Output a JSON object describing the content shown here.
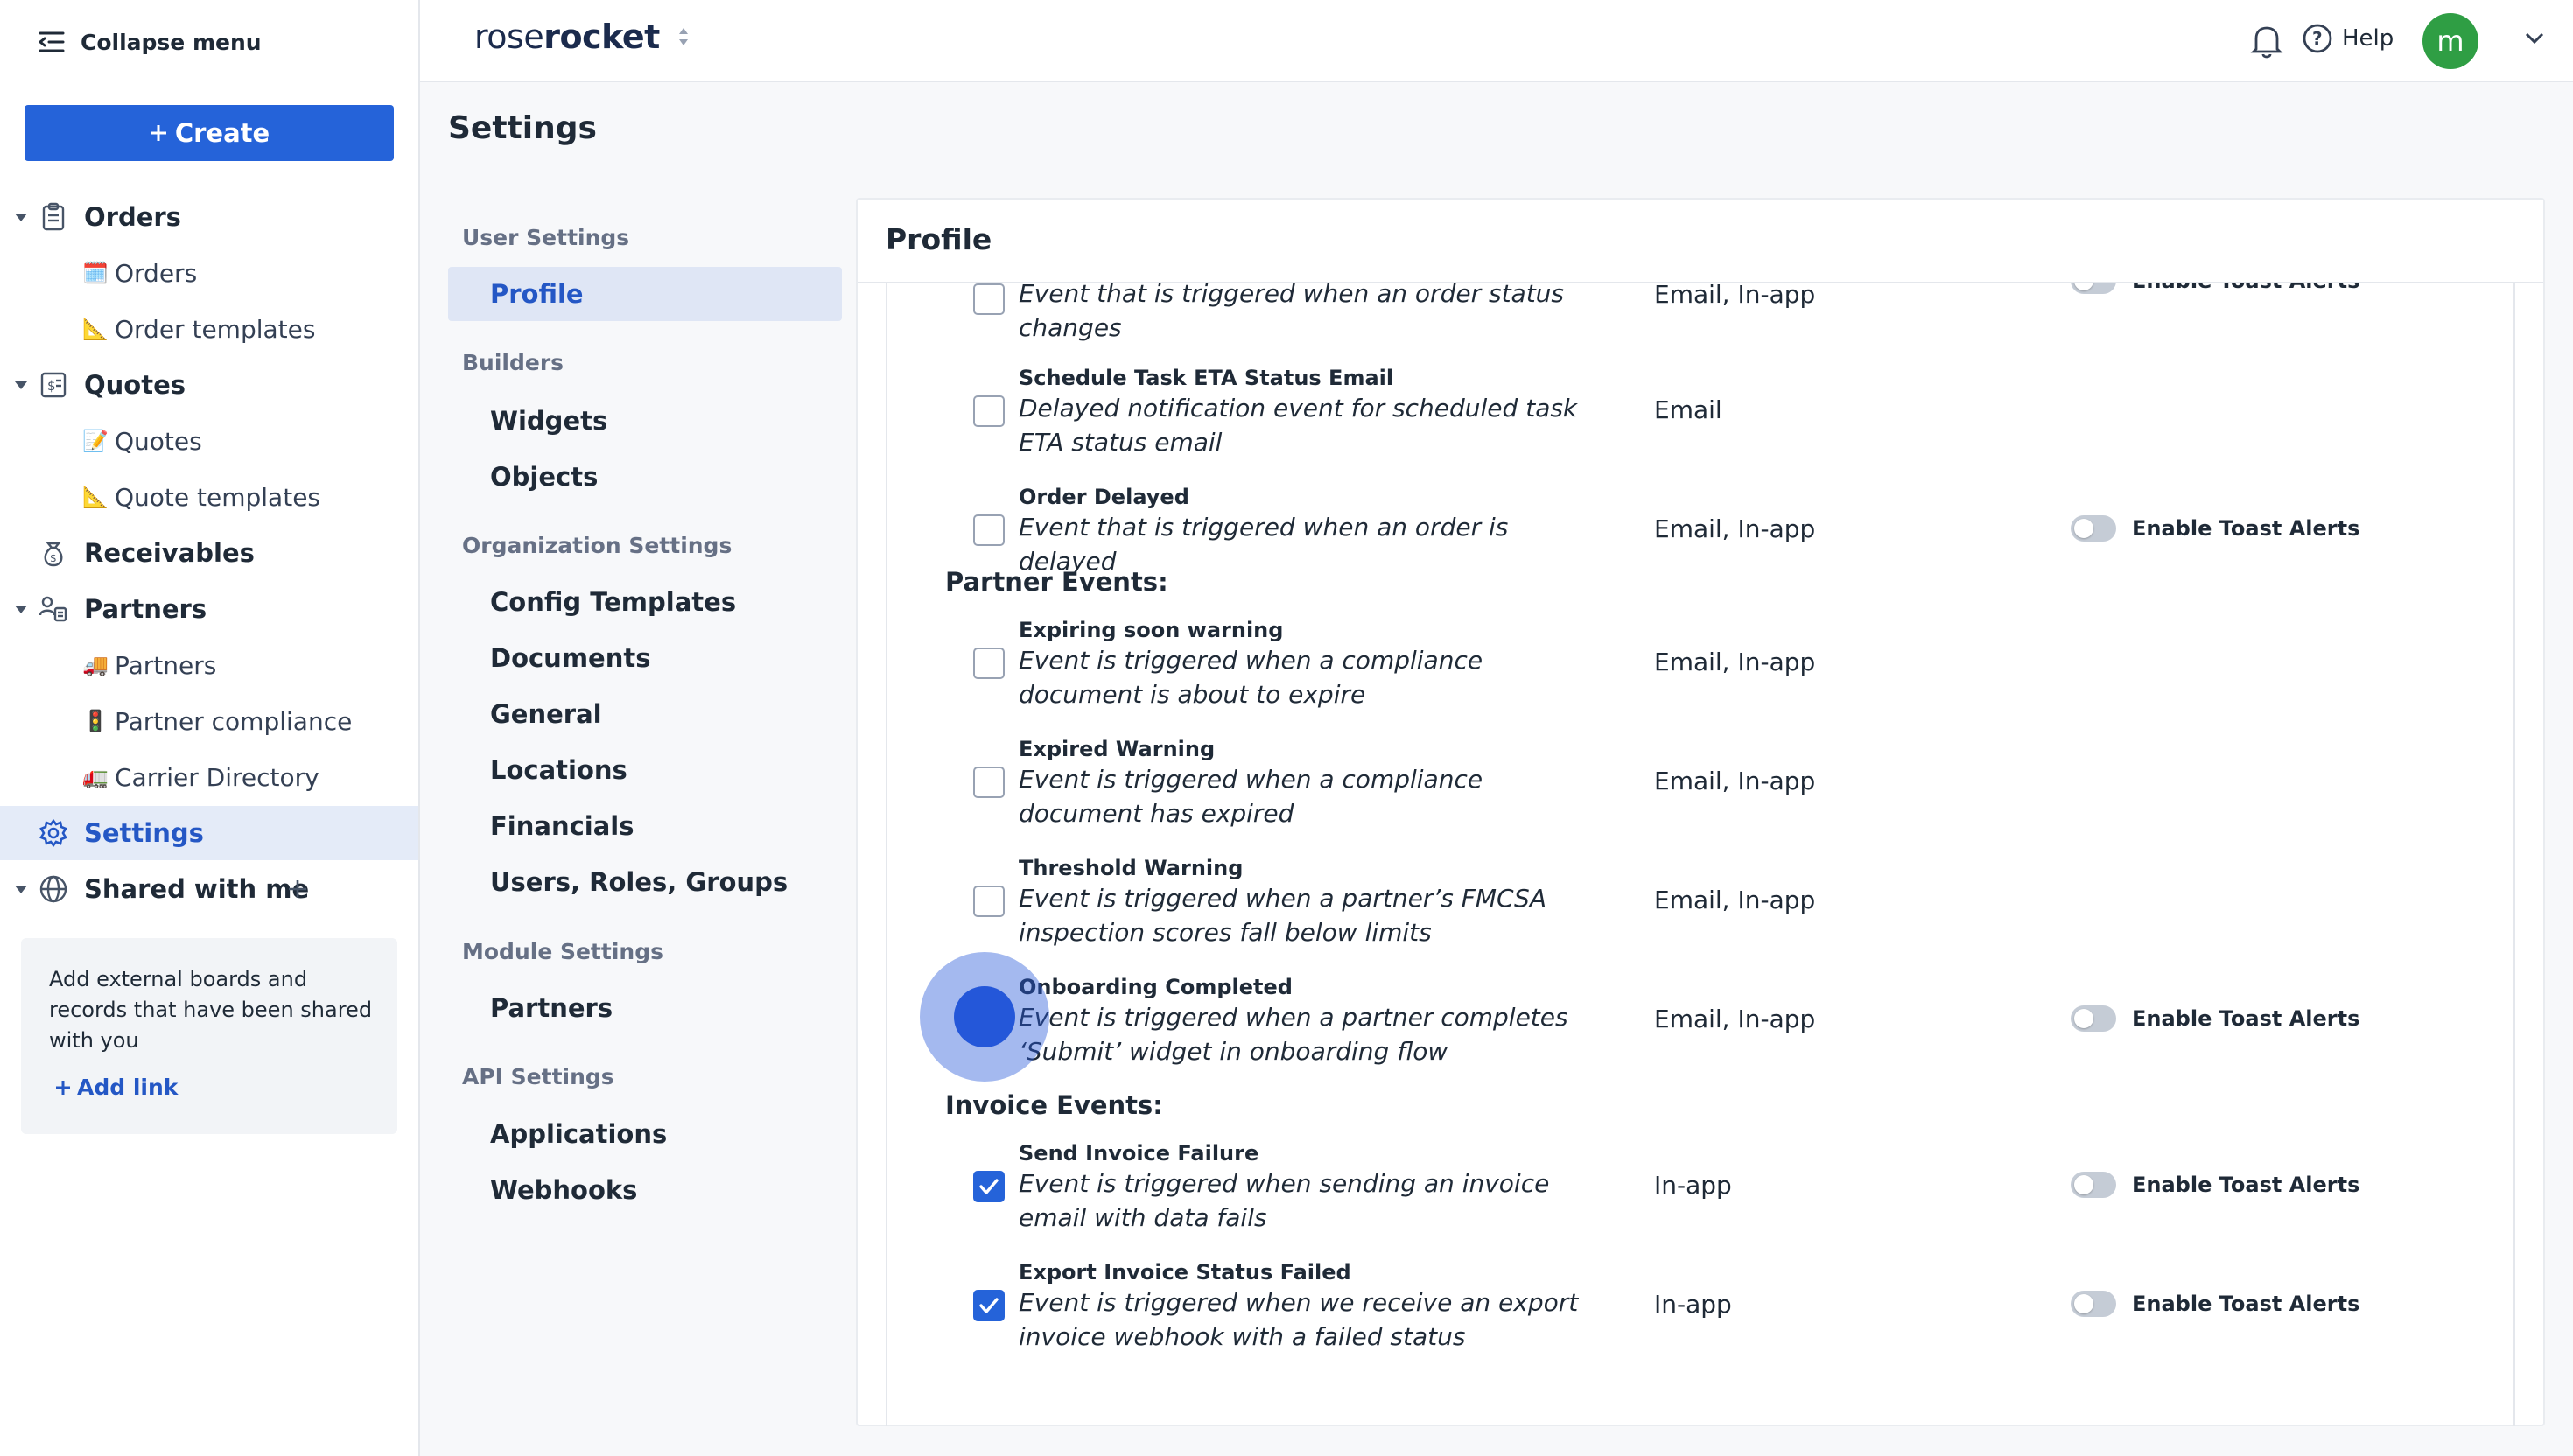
{
  "sidebar": {
    "collapse_label": "Collapse menu",
    "create_label": "Create",
    "items": [
      {
        "label": "Orders"
      },
      {
        "label": "Orders",
        "emoji": "🗓️"
      },
      {
        "label": "Order templates",
        "emoji": "📐"
      },
      {
        "label": "Quotes"
      },
      {
        "label": "Quotes",
        "emoji": "📝"
      },
      {
        "label": "Quote templates",
        "emoji": "📐"
      },
      {
        "label": "Receivables"
      },
      {
        "label": "Partners"
      },
      {
        "label": "Partners",
        "emoji": "🚚"
      },
      {
        "label": "Partner compliance",
        "emoji": "🚦"
      },
      {
        "label": "Carrier Directory",
        "emoji": "🚛"
      },
      {
        "label": "Settings"
      },
      {
        "label": "Shared with me"
      }
    ],
    "shared_box": {
      "text": "Add external boards and records that have been shared with you",
      "add_link_label": "Add link"
    }
  },
  "topbar": {
    "logo_part1": "rose",
    "logo_part2": "rocket",
    "help_label": "Help",
    "avatar_initial": "m"
  },
  "page_title": "Settings",
  "settings_nav": {
    "sections": [
      {
        "title": "User Settings",
        "items": [
          "Profile"
        ]
      },
      {
        "title": "Builders",
        "items": [
          "Widgets",
          "Objects"
        ]
      },
      {
        "title": "Organization Settings",
        "items": [
          "Config Templates",
          "Documents",
          "General",
          "Locations",
          "Financials",
          "Users, Roles, Groups"
        ]
      },
      {
        "title": "Module Settings",
        "items": [
          "Partners"
        ]
      },
      {
        "title": "API Settings",
        "items": [
          "Applications",
          "Webhooks"
        ]
      }
    ],
    "active": "Profile"
  },
  "profile": {
    "title": "Profile",
    "toggle_label": "Enable Toast Alerts",
    "top_row": {
      "desc": "Event that is triggered when an order status changes",
      "channels": "Email, In-app"
    },
    "schedule_eta": {
      "name": "Schedule Task ETA Status Email",
      "desc": "Delayed notification event for scheduled task ETA status email",
      "channels": "Email"
    },
    "order_delayed": {
      "name": "Order Delayed",
      "desc": "Event that is triggered when an order is delayed",
      "channels": "Email, In-app"
    },
    "partner_events_title": "Partner Events:",
    "expiring_soon": {
      "name": "Expiring soon warning",
      "desc": "Event is triggered when a compliance document is about to expire",
      "channels": "Email, In-app"
    },
    "expired": {
      "name": "Expired Warning",
      "desc": "Event is triggered when a compliance document has expired",
      "channels": "Email, In-app"
    },
    "threshold": {
      "name": "Threshold Warning",
      "desc": "Event is triggered when a partner’s FMCSA inspection scores fall below limits",
      "channels": "Email, In-app"
    },
    "onboarding": {
      "name": "Onboarding Completed",
      "desc": "Event is triggered when a partner completes ‘Submit’ widget in onboarding flow",
      "channels": "Email, In-app"
    },
    "invoice_events_title": "Invoice Events:",
    "send_invoice_failure": {
      "name": "Send Invoice Failure",
      "desc": "Event is triggered when sending an invoice email with data fails",
      "channels": "In-app",
      "checked": true
    },
    "export_invoice_failed": {
      "name": "Export Invoice Status Failed",
      "desc": "Event is triggered when we receive an export invoice webhook with a failed status",
      "channels": "In-app",
      "checked": true
    }
  },
  "colors": {
    "accent": "#2563d9",
    "active_nav_bg": "#e4ebf8",
    "avatar_bg": "#2f9e44"
  }
}
